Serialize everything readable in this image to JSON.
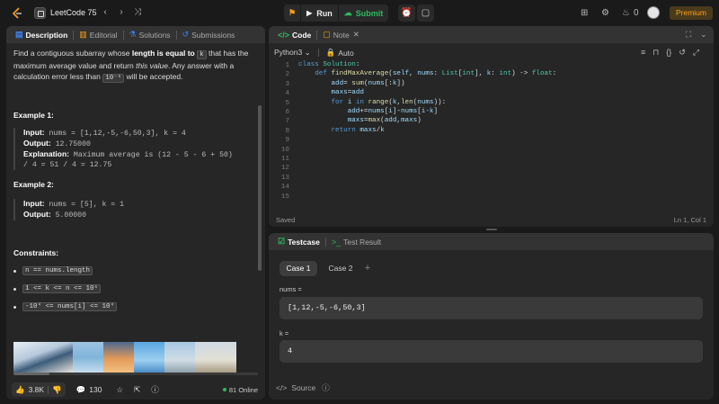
{
  "topbar": {
    "logo_icon": "leetcode-logo",
    "problem_list": "LeetCode 75",
    "run_label": "Run",
    "submit_label": "Submit",
    "streak_count": "0",
    "premium_label": "Premium"
  },
  "left_tabs": [
    "Description",
    "Editorial",
    "Solutions",
    "Submissions"
  ],
  "description": {
    "p1_a": "Find a contiguous subarray whose ",
    "p1_b": "length is equal to",
    "p1_k": "k",
    "p1_c": " that has the maximum average value and return ",
    "p1_d": "this value",
    "p1_e": ". Any answer with a calculation error less than ",
    "p1_err": "10⁻⁵",
    "p1_f": " will be accepted."
  },
  "example1": {
    "heading": "Example 1:",
    "input_label": "Input:",
    "input_value": " nums = [1,12,-5,-6,50,3], k = 4",
    "output_label": "Output:",
    "output_value": " 12.75000",
    "expl_label": "Explanation:",
    "expl_value": " Maximum average is (12 - 5 - 6 + 50)",
    "expl_value2": "/ 4 = 51 / 4 = 12.75"
  },
  "example2": {
    "heading": "Example 2:",
    "input_label": "Input:",
    "input_value": " nums = [5], k = 1",
    "output_label": "Output:",
    "output_value": " 5.00000"
  },
  "constraints": {
    "heading": "Constraints:",
    "items": [
      "n == nums.length",
      "1 <= k <= n <= 10⁵",
      "-10⁴ <= nums[i] <= 10⁴"
    ]
  },
  "footer_left": {
    "likes": "3.8K",
    "comments": "130",
    "online": "81 Online"
  },
  "code_panel": {
    "tabs": [
      "Code",
      "Note"
    ],
    "language": "Python3",
    "auto_label": "Auto",
    "line_numbers": [
      "1",
      "2",
      "3",
      "4",
      "5",
      "6",
      "7",
      "8",
      "9",
      "10",
      "11",
      "12",
      "13",
      "14",
      "15"
    ],
    "status_left": "Saved",
    "status_right": "Ln 1, Col 1"
  },
  "test_panel": {
    "tabs": [
      "Testcase",
      "Test Result"
    ],
    "cases": [
      "Case 1",
      "Case 2"
    ],
    "add_label": "+",
    "nums_label": "nums =",
    "nums_value": "[1,12,-5,-6,50,3]",
    "k_label": "k =",
    "k_value": "4",
    "source_label": "Source"
  },
  "colors": {
    "accent": "#ffa116",
    "submit_green": "#2cbb5d",
    "tab_blue": "#3b82f6"
  }
}
